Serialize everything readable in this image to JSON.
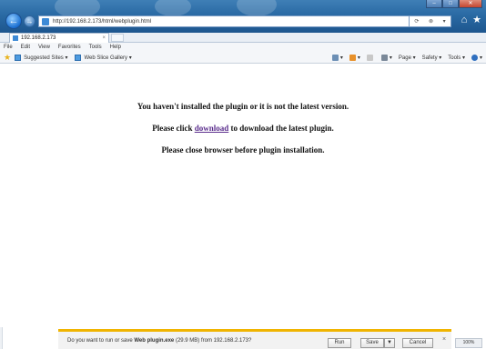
{
  "browser": {
    "url": "http://192.168.2.173/html/webplugin.html",
    "tab_title": "192.168.2.173",
    "tab_close": "×",
    "addr_tools": [
      "⟳",
      "⊗",
      "▾"
    ]
  },
  "menu": [
    "File",
    "Edit",
    "View",
    "Favorites",
    "Tools",
    "Help"
  ],
  "favorites": {
    "items": [
      "Suggested Sites ▾",
      "Web Slice Gallery ▾"
    ]
  },
  "commands": [
    "Page ▾",
    "Safety ▾",
    "Tools ▾"
  ],
  "content": {
    "line1": "You haven't installed the plugin or it is not the latest version.",
    "line2_before": "Please click ",
    "line2_link": "download",
    "line2_after": " to download the latest plugin.",
    "line3": "Please close browser before plugin installation."
  },
  "notification": {
    "text_before": "Do you want to run or save ",
    "filename": "Web plugin.exe",
    "text_after": " (29.9 MB) from 192.168.2.173?",
    "run": "Run",
    "save": "Save",
    "save_menu": "▼",
    "cancel": "Cancel",
    "close": "×"
  },
  "zoom": "100%",
  "colors": {
    "link": "#5a2d8c",
    "notify_accent": "#f0b400",
    "titlebar": "#2a6aa4"
  }
}
